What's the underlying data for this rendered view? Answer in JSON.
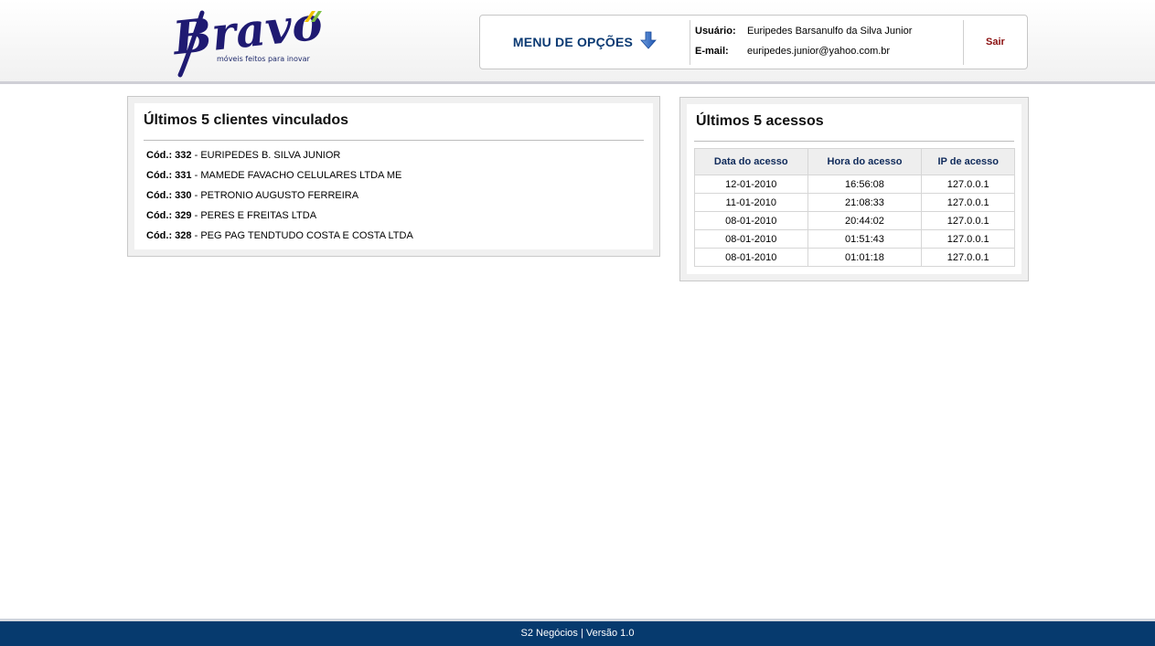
{
  "brand": {
    "logo_text": "Bravo",
    "tagline": "móveis feitos para inovar",
    "colors": {
      "primary": "#1f1a72",
      "accent_yellow": "#f2c200",
      "accent_green": "#7cc242"
    }
  },
  "header": {
    "menu_label": "MENU DE OPÇÕES",
    "menu_icon": "arrow-down-icon",
    "user_label": "Usuário:",
    "user_value": "Euripedes Barsanulfo da Silva Junior",
    "email_label": "E-mail:",
    "email_value": "euripedes.junior@yahoo.com.br",
    "logout_label": "Sair"
  },
  "clients_panel": {
    "title": "Últimos 5 clientes vinculados",
    "items": [
      {
        "code_label": "Cód.:",
        "code": "332",
        "name": "EURIPEDES B. SILVA JUNIOR"
      },
      {
        "code_label": "Cód.:",
        "code": "331",
        "name": "MAMEDE FAVACHO CELULARES LTDA ME"
      },
      {
        "code_label": "Cód.:",
        "code": "330",
        "name": "PETRONIO AUGUSTO FERREIRA"
      },
      {
        "code_label": "Cód.:",
        "code": "329",
        "name": "PERES E FREITAS LTDA"
      },
      {
        "code_label": "Cód.:",
        "code": "328",
        "name": "PEG PAG TENDTUDO COSTA E COSTA LTDA"
      }
    ]
  },
  "access_panel": {
    "title": "Últimos 5 acessos",
    "columns": [
      "Data do acesso",
      "Hora do acesso",
      "IP de acesso"
    ],
    "rows": [
      [
        "12-01-2010",
        "16:56:08",
        "127.0.0.1"
      ],
      [
        "11-01-2010",
        "21:08:33",
        "127.0.0.1"
      ],
      [
        "08-01-2010",
        "20:44:02",
        "127.0.0.1"
      ],
      [
        "08-01-2010",
        "01:51:43",
        "127.0.0.1"
      ],
      [
        "08-01-2010",
        "01:01:18",
        "127.0.0.1"
      ]
    ]
  },
  "footer": {
    "text": "S2 Negócios | Versão 1.0"
  }
}
